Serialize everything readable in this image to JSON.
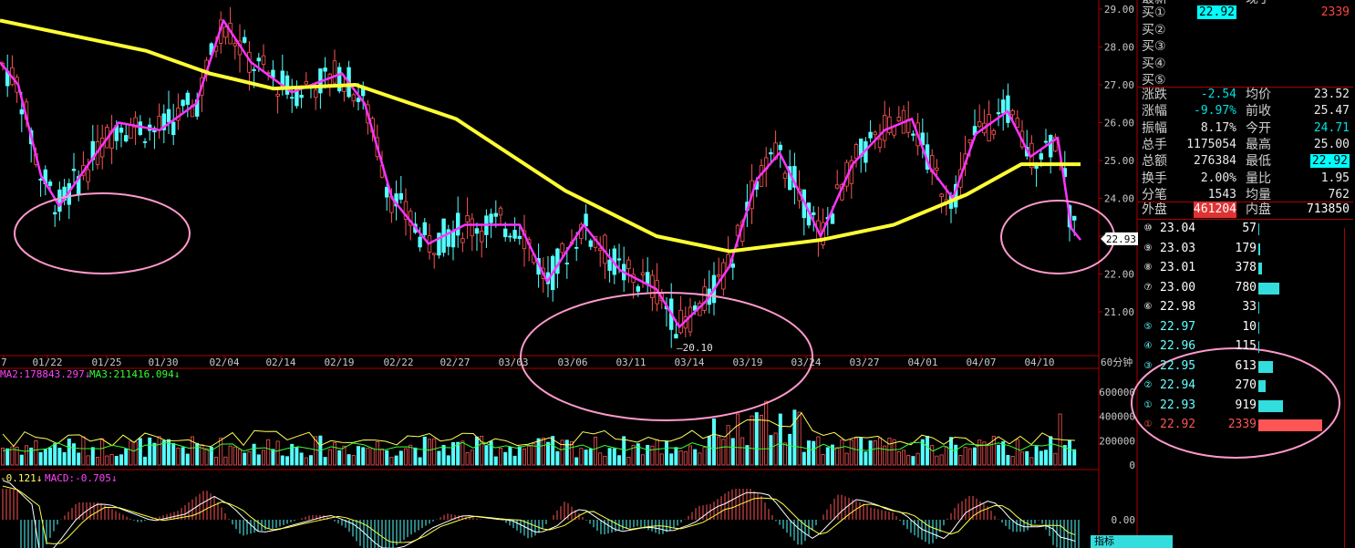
{
  "price_axis": [
    "29.00",
    "28.00",
    "27.00",
    "26.00",
    "25.00",
    "24.00",
    "23.00",
    "22.00",
    "21.00"
  ],
  "current_price_tag": "22.93",
  "low_annotation": "20.10",
  "date_axis": [
    "7",
    "01/22",
    "01/25",
    "01/30",
    "02/04",
    "02/14",
    "02/19",
    "02/22",
    "02/27",
    "03/03",
    "03/06",
    "03/11",
    "03/14",
    "03/19",
    "03/24",
    "03/27",
    "04/01",
    "04/07",
    "04/10"
  ],
  "period_label": "60分钟",
  "volume_header": {
    "ma2": "MA2:178843.297",
    "ma3": "MA3:211416.094"
  },
  "volume_axis": [
    "600000",
    "400000",
    "200000",
    "0"
  ],
  "macd_header": {
    "dea": "-0.121",
    "macd": "MACD:-0.705"
  },
  "macd_axis": "0.00",
  "indicator_button": "指标",
  "quote": {
    "top_cut": {
      "label": "最新",
      "label2": "现手"
    },
    "buys": [
      {
        "label": "买①",
        "price": "22.92",
        "vol": "2339"
      },
      {
        "label": "买②",
        "price": "",
        "vol": ""
      },
      {
        "label": "买③",
        "price": "",
        "vol": ""
      },
      {
        "label": "买④",
        "price": "",
        "vol": ""
      },
      {
        "label": "买⑤",
        "price": "",
        "vol": ""
      }
    ],
    "stats": [
      {
        "l1": "涨跌",
        "v1": "-2.54",
        "l2": "均价",
        "v2": "23.52"
      },
      {
        "l1": "涨幅",
        "v1": "-9.97%",
        "l2": "前收",
        "v2": "25.47"
      },
      {
        "l1": "振幅",
        "v1": "8.17%",
        "l2": "今开",
        "v2": "24.71"
      },
      {
        "l1": "总手",
        "v1": "1175054",
        "l2": "最高",
        "v2": "25.00"
      },
      {
        "l1": "总额",
        "v1": "276384",
        "l2": "最低",
        "v2": "22.92"
      },
      {
        "l1": "换手",
        "v1": "2.00%",
        "l2": "量比",
        "v2": "1.95"
      },
      {
        "l1": "分笔",
        "v1": "1543",
        "l2": "均量",
        "v2": "762"
      }
    ],
    "outer_inner": {
      "l1": "外盘",
      "v1": "461204",
      "l2": "内盘",
      "v2": "713850"
    }
  },
  "order_book": [
    {
      "idx": "⑩",
      "price": "23.04",
      "vol": "57",
      "bar": 0.01
    },
    {
      "idx": "⑨",
      "price": "23.03",
      "vol": "179",
      "bar": 0.03
    },
    {
      "idx": "⑧",
      "price": "23.01",
      "vol": "378",
      "bar": 0.06
    },
    {
      "idx": "⑦",
      "price": "23.00",
      "vol": "780",
      "bar": 0.33
    },
    {
      "idx": "⑥",
      "price": "22.98",
      "vol": "33",
      "bar": 0.01
    },
    {
      "idx": "⑤",
      "price": "22.97",
      "vol": "10",
      "bar": 0.0
    },
    {
      "idx": "④",
      "price": "22.96",
      "vol": "115",
      "bar": 0.02
    },
    {
      "idx": "③",
      "price": "22.95",
      "vol": "613",
      "bar": 0.23
    },
    {
      "idx": "②",
      "price": "22.94",
      "vol": "270",
      "bar": 0.11
    },
    {
      "idx": "①",
      "price": "22.93",
      "vol": "919",
      "bar": 0.38
    },
    {
      "idx": "①",
      "price": "22.92",
      "vol": "2339",
      "bar": 1.0
    }
  ],
  "colors": {
    "up": "#ff5555",
    "down": "#55ffff",
    "ma_pink": "#ff33ff",
    "ma_yellow": "#ffff33",
    "annotation": "#ff99cc"
  }
}
